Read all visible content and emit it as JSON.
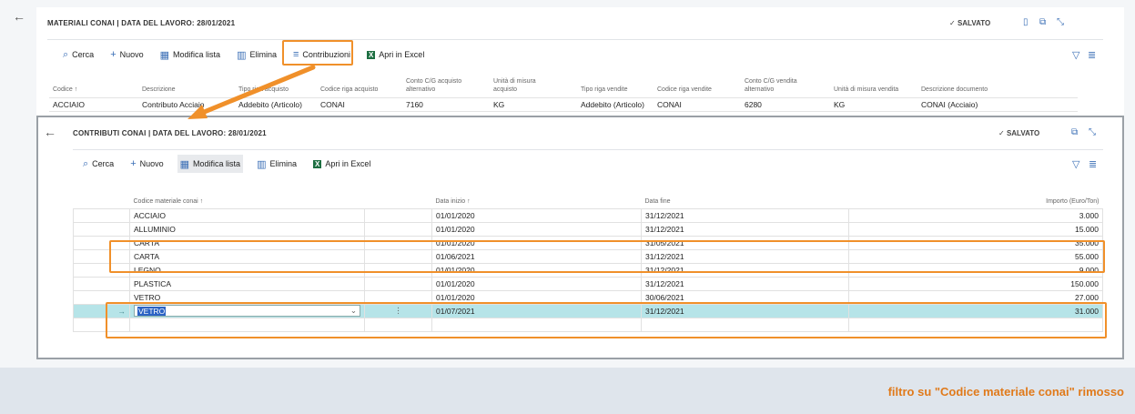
{
  "outer": {
    "title": "MATERIALI CONAI | DATA DEL LAVORO: 28/01/2021",
    "saved": "SALVATO",
    "toolbar": {
      "search": "Cerca",
      "new": "Nuovo",
      "edit_list": "Modifica lista",
      "delete": "Elimina",
      "contributions": "Contribuzioni",
      "open_excel": "Apri in Excel"
    },
    "columns": {
      "c1": "Codice ↑",
      "c2": "Descrizione",
      "c3": "Tipo riga acquisto",
      "c4": "Codice riga acquisto",
      "c5a": "Conto C/G acquisto",
      "c5b": "alternativo",
      "c6a": "Unità di misura",
      "c6b": "acquisto",
      "c7": "Tipo riga vendite",
      "c8": "Codice riga vendite",
      "c9a": "Conto C/G vendita",
      "c9b": "alternativo",
      "c10": "Unità di misura vendita",
      "c11": "Descrizione documento"
    },
    "row": {
      "c1": "ACCIAIO",
      "c2": "Contributo Acciaio",
      "c3": "Addebito (Articolo)",
      "c4": "CONAI",
      "c5": "7160",
      "c6": "KG",
      "c7": "Addebito (Articolo)",
      "c8": "CONAI",
      "c9": "6280",
      "c10": "KG",
      "c11": "CONAI (Acciaio)"
    }
  },
  "inner": {
    "title": "CONTRIBUTI CONAI | DATA DEL LAVORO: 28/01/2021",
    "saved": "SALVATO",
    "toolbar": {
      "search": "Cerca",
      "new": "Nuovo",
      "edit_list": "Modifica lista",
      "delete": "Elimina",
      "open_excel": "Apri in Excel"
    },
    "columns": {
      "code": "Codice materiale conai ↑",
      "start": "Data inizio ↑",
      "end": "Data fine",
      "amount": "Importo (Euro/Ton)"
    },
    "rows": [
      {
        "code": "ACCIAIO",
        "start": "01/01/2020",
        "end": "31/12/2021",
        "amount": "3.000"
      },
      {
        "code": "ALLUMINIO",
        "start": "01/01/2020",
        "end": "31/12/2021",
        "amount": "15.000"
      },
      {
        "code": "CARTA",
        "start": "01/01/2020",
        "end": "31/05/2021",
        "amount": "35.000"
      },
      {
        "code": "CARTA",
        "start": "01/06/2021",
        "end": "31/12/2021",
        "amount": "55.000"
      },
      {
        "code": "LEGNO",
        "start": "01/01/2020",
        "end": "31/12/2021",
        "amount": "9.000"
      },
      {
        "code": "PLASTICA",
        "start": "01/01/2020",
        "end": "31/12/2021",
        "amount": "150.000"
      },
      {
        "code": "VETRO",
        "start": "01/01/2020",
        "end": "30/06/2021",
        "amount": "27.000"
      },
      {
        "code": "VETRO",
        "start": "01/07/2021",
        "end": "31/12/2021",
        "amount": "31.000"
      }
    ]
  },
  "caption": "filtro su \"Codice materiale conai\" rimosso",
  "colors": {
    "highlight": "#f0902a",
    "selected_row": "#b6e4e8",
    "accent": "#3b6fb6",
    "caption": "#e07a1b"
  }
}
